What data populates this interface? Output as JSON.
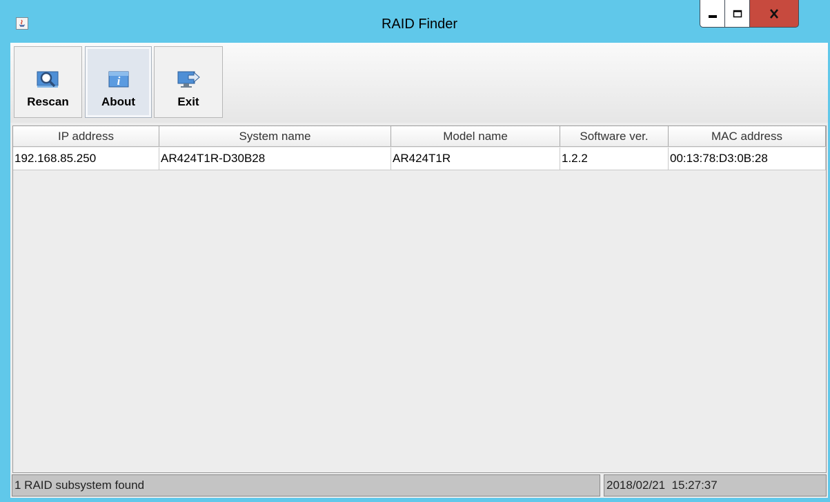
{
  "window": {
    "title": "RAID Finder"
  },
  "toolbar": {
    "rescan_label": "Rescan",
    "about_label": "About",
    "exit_label": "Exit"
  },
  "table": {
    "columns": [
      "IP address",
      "System name",
      "Model name",
      "Software ver.",
      "MAC address"
    ],
    "rows": [
      {
        "ip": "192.168.85.250",
        "system_name": "AR424T1R-D30B28",
        "model_name": "AR424T1R",
        "software_ver": "1.2.2",
        "mac": "00:13:78:D3:0B:28"
      }
    ]
  },
  "status": {
    "message": "1 RAID subsystem found",
    "datetime": "2018/02/21  15:27:37"
  },
  "colors": {
    "titlebar": "#60c8ea",
    "close_button": "#c74a3e"
  },
  "icons": {
    "app": "java-app-icon",
    "rescan": "magnifier-icon",
    "about": "info-icon",
    "exit": "exit-monitor-icon"
  }
}
